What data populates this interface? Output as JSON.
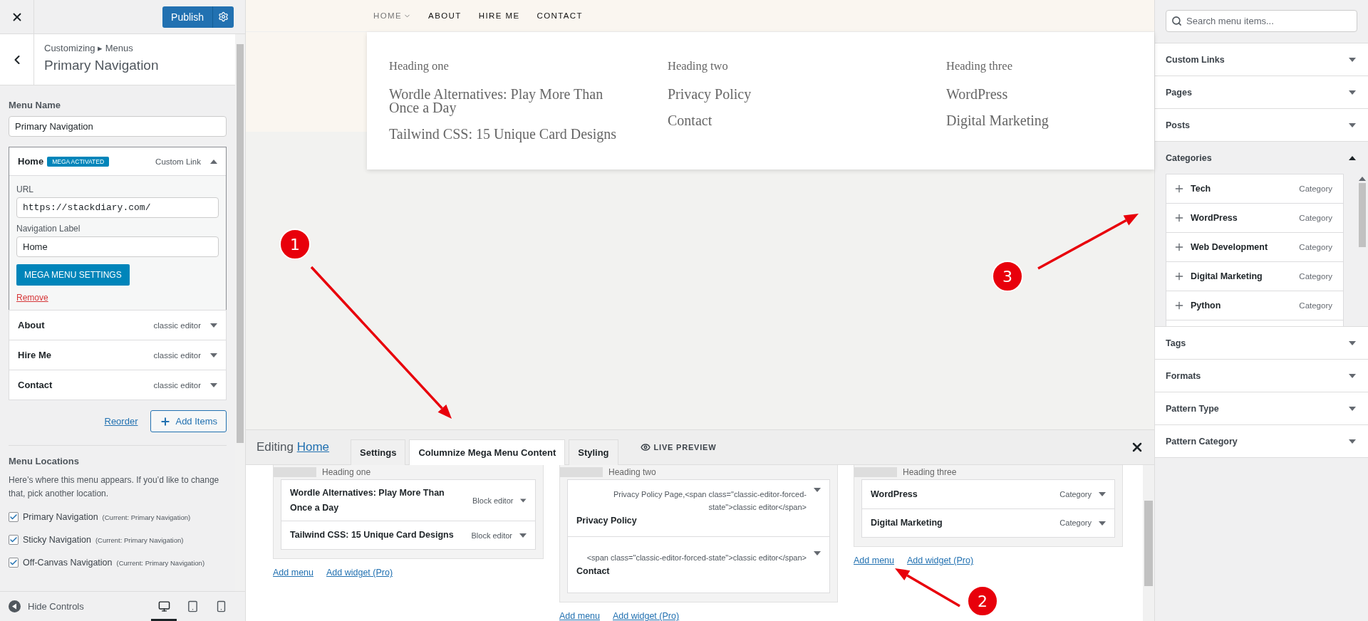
{
  "customizer": {
    "publish": "Publish",
    "breadcrumb": "Customizing ▸ Menus",
    "title": "Primary Navigation",
    "menu_name_label": "Menu Name",
    "menu_name_value": "Primary Navigation",
    "menu_items": [
      {
        "title": "Home",
        "badge": "MEGA ACTIVATED",
        "type": "Custom Link",
        "expanded": true,
        "url_label": "URL",
        "url": "https://stackdiary.com/",
        "nav_label_label": "Navigation Label",
        "nav_label": "Home",
        "settings_button": "MEGA MENU SETTINGS",
        "remove": "Remove"
      },
      {
        "title": "About",
        "type": "classic editor",
        "expanded": false
      },
      {
        "title": "Hire Me",
        "type": "classic editor",
        "expanded": false
      },
      {
        "title": "Contact",
        "type": "classic editor",
        "expanded": false
      }
    ],
    "reorder": "Reorder",
    "add_items": "Add Items",
    "locations_title": "Menu Locations",
    "locations_desc": "Here’s where this menu appears. If you’d like to change that, pick another location.",
    "locations": [
      {
        "name": "Primary Navigation",
        "current": "(Current: Primary Navigation)",
        "checked": true
      },
      {
        "name": "Sticky Navigation",
        "current": "(Current: Primary Navigation)",
        "checked": true
      },
      {
        "name": "Off-Canvas Navigation",
        "current": "(Current: Primary Navigation)",
        "checked": true
      }
    ],
    "hide_controls": "Hide Controls",
    "devices": [
      {
        "kind": "desktop",
        "selected": true
      },
      {
        "kind": "tablet",
        "selected": false
      },
      {
        "kind": "mobile",
        "selected": false
      }
    ]
  },
  "preview": {
    "nav": [
      {
        "label": "HOME",
        "dropdown": true,
        "selected": true
      },
      {
        "label": "ABOUT",
        "dropdown": false,
        "selected": false
      },
      {
        "label": "HIRE ME",
        "dropdown": false,
        "selected": false
      },
      {
        "label": "CONTACT",
        "dropdown": false,
        "selected": false
      }
    ],
    "mega_columns": [
      {
        "heading": "Heading one",
        "links": [
          "Wordle Alternatives: Play More Than Once a Day",
          "Tailwind CSS: 15 Unique Card Designs"
        ]
      },
      {
        "heading": "Heading two",
        "links": [
          "Privacy Policy",
          "Contact"
        ]
      },
      {
        "heading": "Heading three",
        "links": [
          "WordPress",
          "Digital Marketing"
        ]
      }
    ]
  },
  "editor": {
    "editing": "Editing",
    "editing_link": "Home",
    "tabs": [
      {
        "label": "Settings",
        "selected": false
      },
      {
        "label": "Columnize Mega Menu Content",
        "selected": true
      },
      {
        "label": "Styling",
        "selected": false
      }
    ],
    "live_preview": "LIVE PREVIEW",
    "columns": [
      {
        "heading": "Heading one",
        "items": [
          {
            "kind": "inline",
            "title": "Wordle Alternatives: Play More Than Once a Day",
            "type": "Block editor"
          },
          {
            "kind": "inline",
            "title": "Tailwind CSS: 15 Unique Card Designs",
            "type": "Block editor"
          }
        ],
        "add_menu": "Add menu",
        "add_widget": "Add widget (Pro)"
      },
      {
        "heading": "Heading two",
        "items": [
          {
            "kind": "stacked",
            "title": "Privacy Policy",
            "type": "Privacy Policy Page,<span class=\"classic-editor-forced-state\">classic editor</span>"
          },
          {
            "kind": "stacked",
            "title": "Contact",
            "type": "<span class=\"classic-editor-forced-state\">classic editor</span>"
          }
        ],
        "add_menu": "Add menu",
        "add_widget": "Add widget (Pro)"
      },
      {
        "heading": "Heading three",
        "items": [
          {
            "kind": "inline",
            "title": "WordPress",
            "type": "Category"
          },
          {
            "kind": "inline",
            "title": "Digital Marketing",
            "type": "Category"
          }
        ],
        "add_menu": "Add menu",
        "add_widget": "Add widget (Pro)"
      }
    ]
  },
  "item_panel": {
    "search": {
      "placeholder": "Search menu items..."
    },
    "sections": [
      {
        "title": "Custom Links",
        "expanded": false
      },
      {
        "title": "Pages",
        "expanded": false
      },
      {
        "title": "Posts",
        "expanded": false
      },
      {
        "title": "Categories",
        "expanded": true,
        "items": [
          {
            "name": "Tech",
            "type": "Category"
          },
          {
            "name": "WordPress",
            "type": "Category"
          },
          {
            "name": "Web Development",
            "type": "Category"
          },
          {
            "name": "Digital Marketing",
            "type": "Category"
          },
          {
            "name": "Python",
            "type": "Category"
          }
        ]
      },
      {
        "title": "Tags",
        "expanded": false
      },
      {
        "title": "Formats",
        "expanded": false
      },
      {
        "title": "Pattern Type",
        "expanded": false
      },
      {
        "title": "Pattern Category",
        "expanded": false
      }
    ]
  },
  "annotations": [
    {
      "number": "1"
    },
    {
      "number": "2"
    },
    {
      "number": "3"
    }
  ]
}
